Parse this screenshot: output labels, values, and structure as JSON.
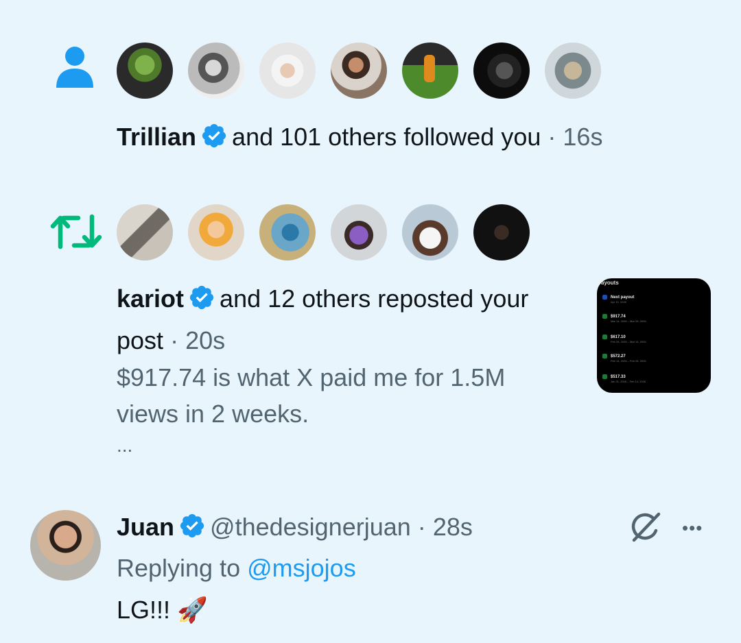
{
  "follow_notification": {
    "icon": "person-icon",
    "accent_color": "#1d9bf0",
    "avatars": [
      {
        "name": "avatar-goblin"
      },
      {
        "name": "avatar-bearded-man"
      },
      {
        "name": "avatar-woman-bun"
      },
      {
        "name": "avatar-woman-restaurant"
      },
      {
        "name": "avatar-soccer-player"
      },
      {
        "name": "avatar-dice"
      },
      {
        "name": "avatar-book"
      }
    ],
    "actor": "Trillian",
    "text": "and 101 others followed you",
    "separator": "·",
    "time": "16s"
  },
  "repost_notification": {
    "icon": "repost-icon",
    "accent_color": "#00ba7c",
    "avatars": [
      {
        "name": "avatar-car-interior"
      },
      {
        "name": "avatar-anime-ninja"
      },
      {
        "name": "avatar-fantasy-scene"
      },
      {
        "name": "avatar-man-office"
      },
      {
        "name": "avatar-woman-phone"
      },
      {
        "name": "avatar-man-dark"
      }
    ],
    "actor": "kariot",
    "text_line1": "and 12 others reposted your",
    "text_line2": "post",
    "separator": "·",
    "time": "20s",
    "preview_line1": "$917.74 is what X paid me for 1.5M",
    "preview_line2": "views in 2 weeks.",
    "preview_more": "...",
    "thumbnail": {
      "header": "ayouts",
      "rows": [
        {
          "amount": "Next payout",
          "sub": "Apr 10, 2026"
        },
        {
          "amount": "$917.74",
          "sub": "Mar 14, 2026 – Mar 28, 2026"
        },
        {
          "amount": "$617.10",
          "sub": "Feb 28, 2026 – Mar 14, 2026"
        },
        {
          "amount": "$572.27",
          "sub": "Feb 14, 2026 – Feb 28, 2026"
        },
        {
          "amount": "$517.33",
          "sub": "Jan 31, 2026 – Feb 14, 2026"
        }
      ]
    }
  },
  "reply": {
    "author_name": "Juan",
    "handle": "@thedesignerjuan",
    "separator": "·",
    "time": "28s",
    "replying_prefix": "Replying to",
    "replying_to": "@msjojos",
    "text": "LG!!!",
    "emoji": "🚀",
    "more_label": "•••"
  },
  "colors": {
    "background": "#e8f5fd",
    "verified": "#1d9bf0",
    "link": "#1d9bf0",
    "muted": "#536471"
  }
}
